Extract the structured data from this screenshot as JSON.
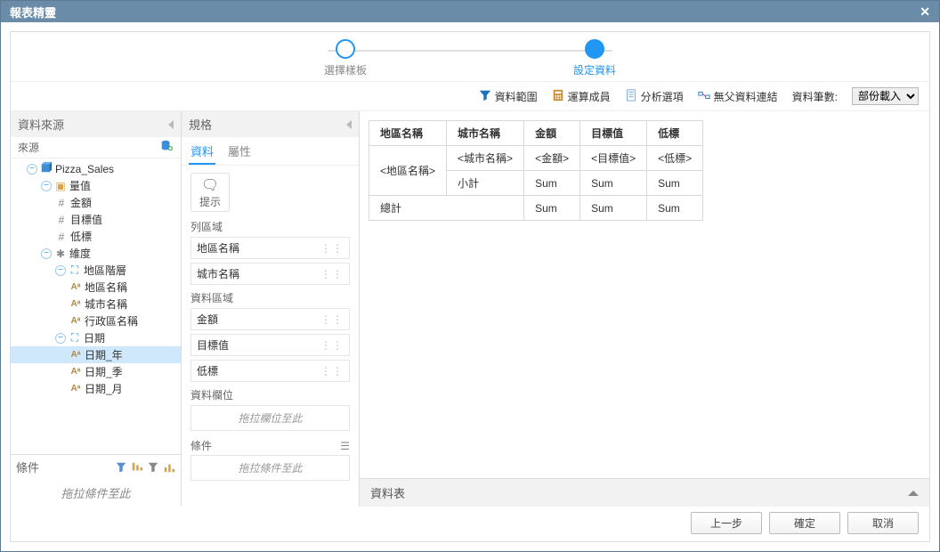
{
  "title": "報表精靈",
  "steps": [
    {
      "label": "選擇樣板",
      "active": false
    },
    {
      "label": "設定資料",
      "active": true
    }
  ],
  "toolbar": {
    "data_scope": "資料範圍",
    "calc_members": "運算成員",
    "analysis_options": "分析選項",
    "no_parent_link": "無父資料連結",
    "record_count_label": "資料筆數:",
    "record_count_value": "部份載入"
  },
  "source_panel": {
    "title": "資料來源",
    "source_label": "來源",
    "dataset": "Pizza_Sales",
    "measures_label": "量值",
    "measures": [
      "金額",
      "目標值",
      "低標"
    ],
    "dimensions_label": "維度",
    "hier_region": "地區階層",
    "region_attrs": [
      "地區名稱",
      "城市名稱",
      "行政區名稱"
    ],
    "hier_date": "日期",
    "date_attrs": [
      "日期_年",
      "日期_季",
      "日期_月"
    ],
    "selected_node": "日期_年"
  },
  "conditions_panel": {
    "title": "條件",
    "placeholder": "拖拉條件至此"
  },
  "spec_panel": {
    "title": "規格",
    "tabs": {
      "data": "資料",
      "attrs": "屬性"
    },
    "hint": "提示",
    "row_area_label": "列區域",
    "row_items": [
      "地區名稱",
      "城市名稱"
    ],
    "data_area_label": "資料區域",
    "data_items": [
      "金額",
      "目標值",
      "低標"
    ],
    "data_field_label": "資料欄位",
    "data_field_placeholder": "拖拉欄位至此",
    "cond_label": "條件",
    "cond_placeholder": "拖拉條件至此"
  },
  "preview": {
    "headers": [
      "地區名稱",
      "城市名稱",
      "金額",
      "目標值",
      "低標"
    ],
    "row_region": "<地區名稱>",
    "row_city": "<城市名稱>",
    "vals": [
      "<金額>",
      "<目標值>",
      "<低標>"
    ],
    "subtotal": "小計",
    "total": "總計",
    "sum": "Sum"
  },
  "data_table_label": "資料表",
  "footer": {
    "prev": "上一步",
    "ok": "確定",
    "cancel": "取消"
  }
}
